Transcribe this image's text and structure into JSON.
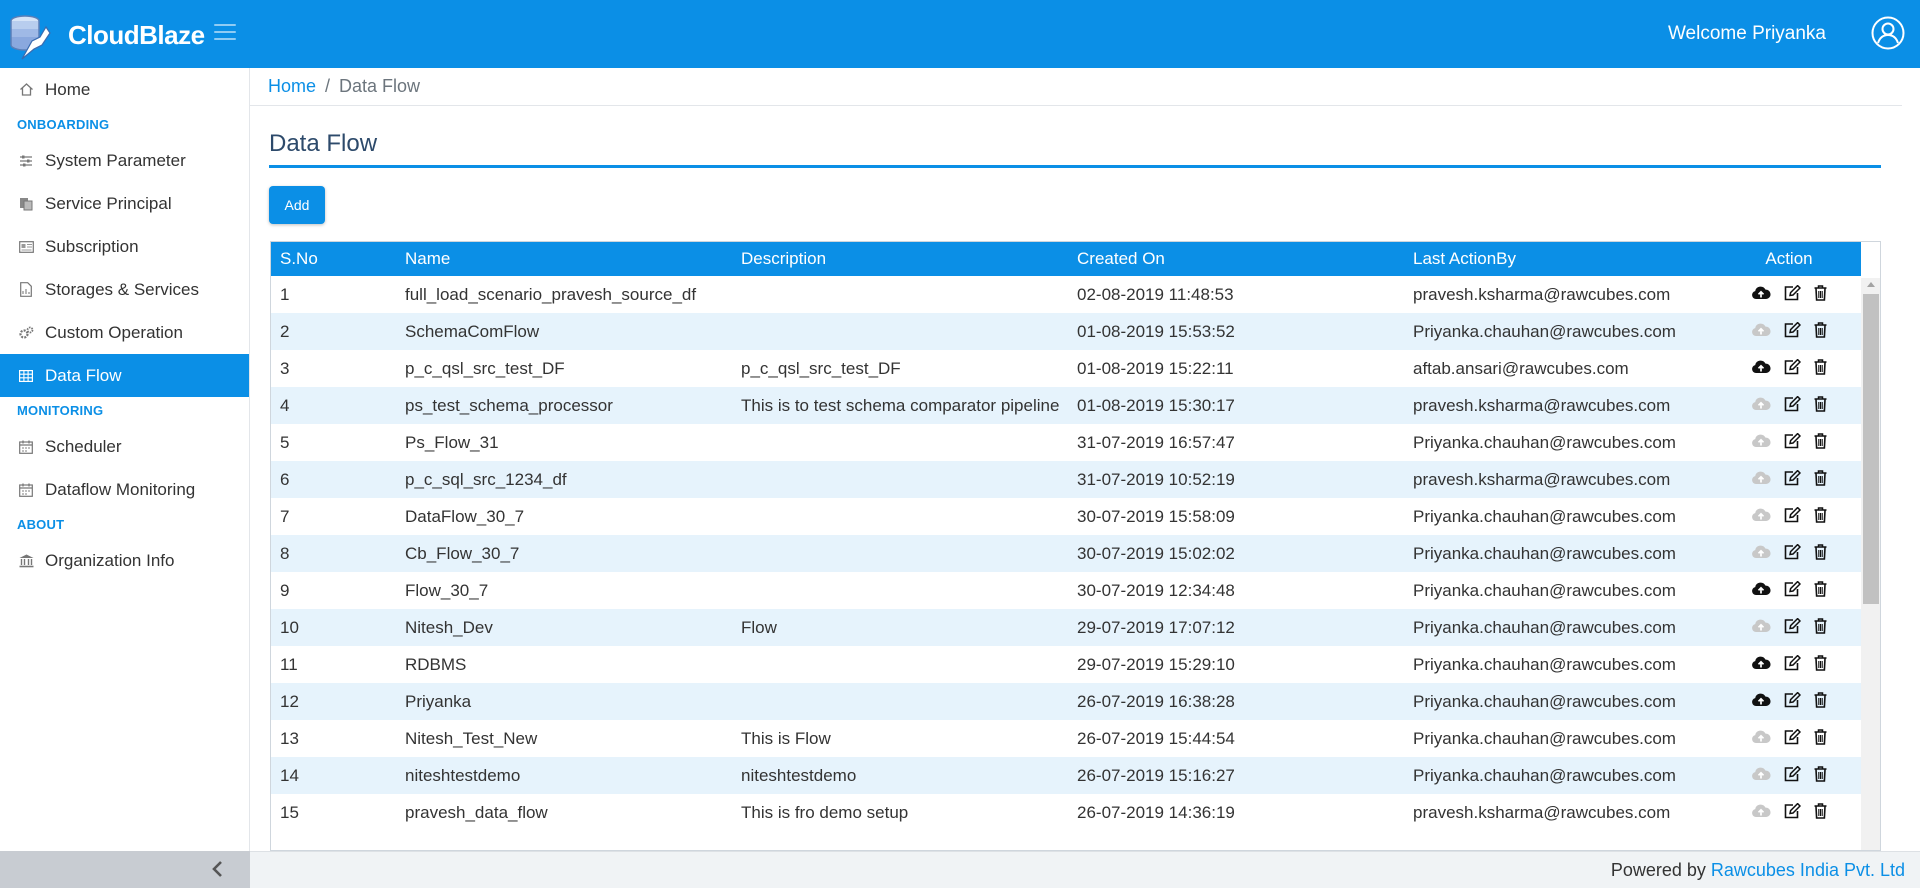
{
  "app": {
    "brand": "CloudBlaze",
    "welcome": "Welcome Priyanka"
  },
  "sidebar": {
    "home": "Home",
    "onboarding": {
      "heading": "ONBOARDING",
      "items": [
        "System Parameter",
        "Service Principal",
        "Subscription",
        "Storages & Services",
        "Custom Operation",
        "Data Flow"
      ]
    },
    "monitoring": {
      "heading": "MONITORING",
      "items": [
        "Scheduler",
        "Dataflow Monitoring"
      ]
    },
    "about": {
      "heading": "ABOUT",
      "items": [
        "Organization Info"
      ]
    },
    "active_item": "Data Flow"
  },
  "breadcrumb": {
    "home": "Home",
    "separator": "/",
    "current": "Data Flow"
  },
  "page": {
    "title": "Data Flow",
    "add_label": "Add"
  },
  "table": {
    "columns": [
      "S.No",
      "Name",
      "Description",
      "Created On",
      "Last ActionBy",
      "Action"
    ],
    "rows": [
      {
        "sno": "1",
        "name": "full_load_scenario_pravesh_source_df",
        "description": "",
        "created": "02-08-2019 11:48:53",
        "by": "pravesh.ksharma@rawcubes.com",
        "upload_enabled": true
      },
      {
        "sno": "2",
        "name": "SchemaComFlow",
        "description": "",
        "created": "01-08-2019 15:53:52",
        "by": "Priyanka.chauhan@rawcubes.com",
        "upload_enabled": false
      },
      {
        "sno": "3",
        "name": "p_c_qsl_src_test_DF",
        "description": "p_c_qsl_src_test_DF",
        "created": "01-08-2019 15:22:11",
        "by": "aftab.ansari@rawcubes.com",
        "upload_enabled": true
      },
      {
        "sno": "4",
        "name": "ps_test_schema_processor",
        "description": "This is to test schema comparator pipeline",
        "created": "01-08-2019 15:30:17",
        "by": "pravesh.ksharma@rawcubes.com",
        "upload_enabled": false
      },
      {
        "sno": "5",
        "name": "Ps_Flow_31",
        "description": "",
        "created": "31-07-2019 16:57:47",
        "by": "Priyanka.chauhan@rawcubes.com",
        "upload_enabled": false
      },
      {
        "sno": "6",
        "name": "p_c_sql_src_1234_df",
        "description": "",
        "created": "31-07-2019 10:52:19",
        "by": "pravesh.ksharma@rawcubes.com",
        "upload_enabled": false
      },
      {
        "sno": "7",
        "name": "DataFlow_30_7",
        "description": "",
        "created": "30-07-2019 15:58:09",
        "by": "Priyanka.chauhan@rawcubes.com",
        "upload_enabled": false
      },
      {
        "sno": "8",
        "name": "Cb_Flow_30_7",
        "description": "",
        "created": "30-07-2019 15:02:02",
        "by": "Priyanka.chauhan@rawcubes.com",
        "upload_enabled": false
      },
      {
        "sno": "9",
        "name": "Flow_30_7",
        "description": "",
        "created": "30-07-2019 12:34:48",
        "by": "Priyanka.chauhan@rawcubes.com",
        "upload_enabled": true
      },
      {
        "sno": "10",
        "name": "Nitesh_Dev",
        "description": "Flow",
        "created": "29-07-2019 17:07:12",
        "by": "Priyanka.chauhan@rawcubes.com",
        "upload_enabled": false
      },
      {
        "sno": "11",
        "name": "RDBMS",
        "description": "",
        "created": "29-07-2019 15:29:10",
        "by": "Priyanka.chauhan@rawcubes.com",
        "upload_enabled": true
      },
      {
        "sno": "12",
        "name": "Priyanka",
        "description": "",
        "created": "26-07-2019 16:38:28",
        "by": "Priyanka.chauhan@rawcubes.com",
        "upload_enabled": true
      },
      {
        "sno": "13",
        "name": "Nitesh_Test_New",
        "description": "This is Flow",
        "created": "26-07-2019 15:44:54",
        "by": "Priyanka.chauhan@rawcubes.com",
        "upload_enabled": false
      },
      {
        "sno": "14",
        "name": "niteshtestdemo",
        "description": "niteshtestdemo",
        "created": "26-07-2019 15:16:27",
        "by": "Priyanka.chauhan@rawcubes.com",
        "upload_enabled": false
      },
      {
        "sno": "15",
        "name": "pravesh_data_flow",
        "description": "This is fro demo setup",
        "created": "26-07-2019 14:36:19",
        "by": "pravesh.ksharma@rawcubes.com",
        "upload_enabled": false
      }
    ]
  },
  "icons": {
    "upload": "cloud-upload-icon",
    "edit": "edit-icon",
    "delete": "trash-icon"
  },
  "colors": {
    "primary": "#0b8fe6",
    "row_alt": "#e6f3fc",
    "icon_disabled": "#c8c8c8"
  },
  "footer": {
    "powered_by": "Powered by",
    "company": "Rawcubes India Pvt. Ltd"
  }
}
